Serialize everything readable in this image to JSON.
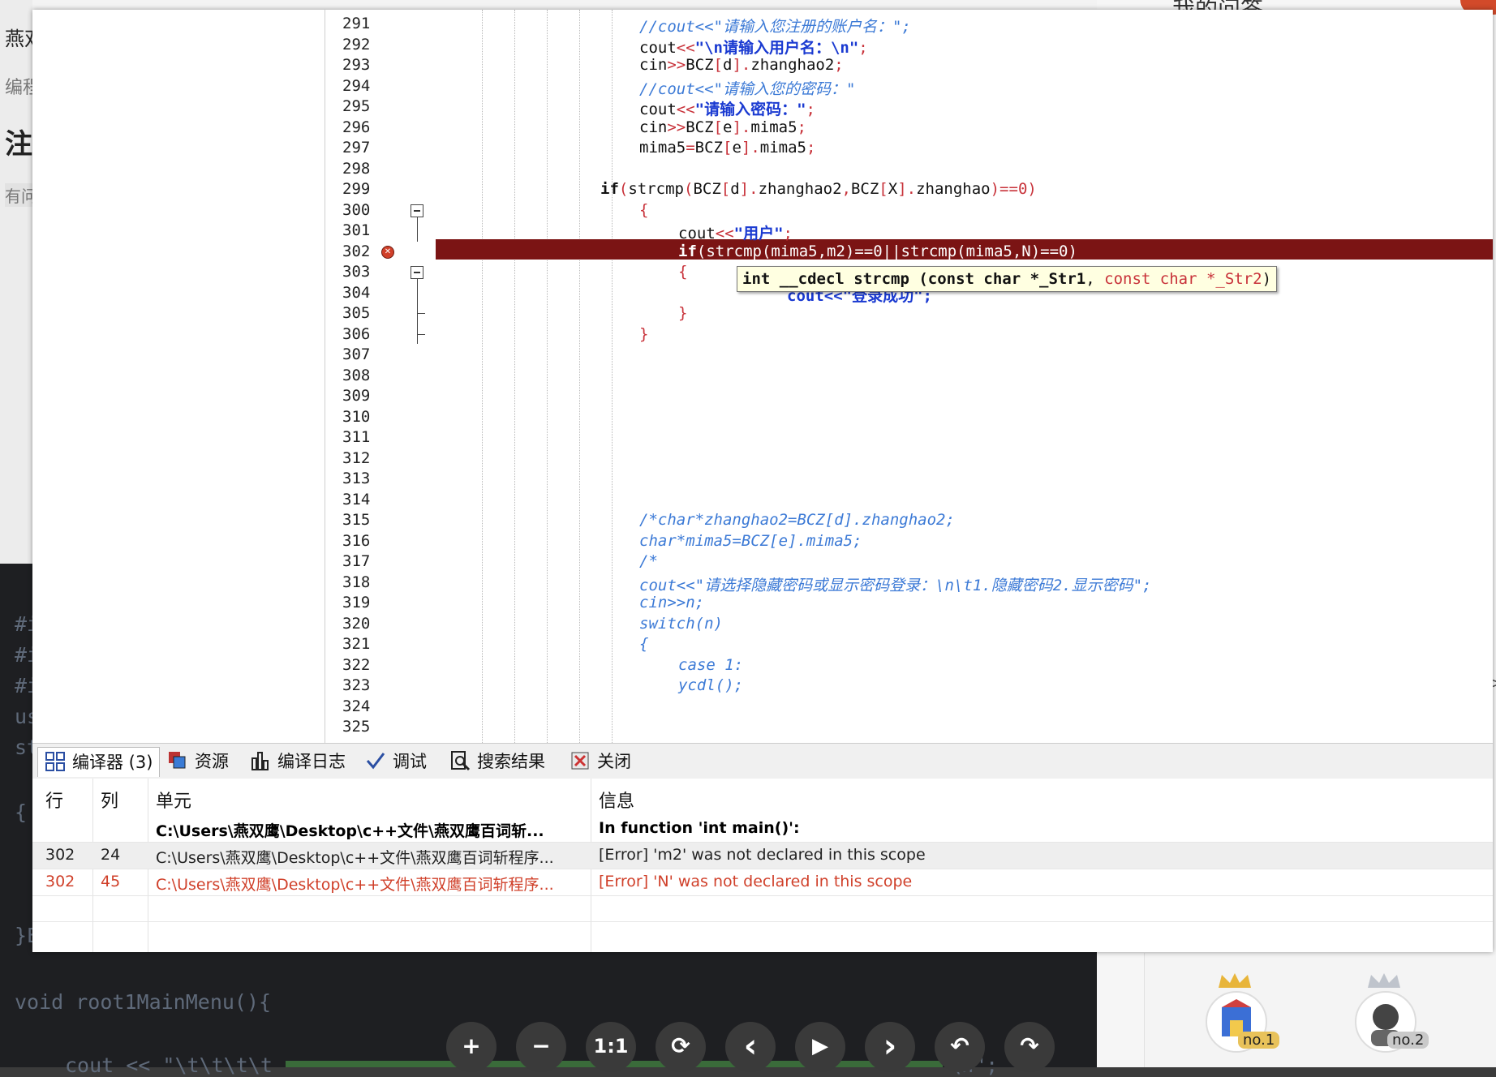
{
  "background": {
    "left_texts": [
      "燕双",
      "编程",
      "注",
      "有问"
    ],
    "right_title": "我的问答",
    "code_lines": [
      "#i",
      "#i",
      "#i",
      "us",
      "st",
      "{",
      "}E",
      "void root1MainMenu(){",
      "cout << \"\\t\\t\\t\\t",
      "\\n\";"
    ],
    "rank_1": "no.1",
    "rank_2": "no.2"
  },
  "editor": {
    "line_numbers": [
      "291",
      "292",
      "293",
      "294",
      "295",
      "296",
      "297",
      "298",
      "299",
      "300",
      "301",
      "302",
      "303",
      "304",
      "305",
      "306",
      "307",
      "308",
      "309",
      "310",
      "311",
      "312",
      "313",
      "314",
      "315",
      "316",
      "317",
      "318",
      "319",
      "320",
      "321",
      "322",
      "323",
      "324",
      "325"
    ],
    "tooltip": {
      "prefix": "int __cdecl strcmp (",
      "p1": "const char *_Str1",
      "sep": ", ",
      "p2": "const char *_Str2",
      "suffix": ")"
    },
    "hidden_line_fragment": "cout<<\"登录成功\";"
  },
  "tabs": [
    {
      "label": "编译器 (3)",
      "icon": "compiler-grid-icon"
    },
    {
      "label": "资源",
      "icon": "resources-icon"
    },
    {
      "label": "编译日志",
      "icon": "bar-chart-icon"
    },
    {
      "label": "调试",
      "icon": "checkmark-icon"
    },
    {
      "label": "搜索结果",
      "icon": "search-document-icon"
    },
    {
      "label": "关闭",
      "icon": "close-panel-icon"
    }
  ],
  "messages": {
    "headers": {
      "line": "行",
      "col": "列",
      "unit": "单元",
      "info": "信息"
    },
    "rows": [
      {
        "line": "",
        "col": "",
        "unit": "C:\\Users\\燕双鹰\\Desktop\\c++文件\\燕双鹰百词斩...",
        "info": "In function 'int main()':"
      },
      {
        "line": "302",
        "col": "24",
        "unit": "C:\\Users\\燕双鹰\\Desktop\\c++文件\\燕双鹰百词斩程序...",
        "info": "[Error] 'm2' was not declared in this scope"
      },
      {
        "line": "302",
        "col": "45",
        "unit": "C:\\Users\\燕双鹰\\Desktop\\c++文件\\燕双鹰百词斩程序...",
        "info": "[Error] 'N' was not declared in this scope"
      }
    ]
  },
  "viewer_toolbar": {
    "zoom_in": "+",
    "zoom_out": "−",
    "actual_size": "1:1",
    "rotate": "⟳",
    "prev": "‹",
    "play": "▶",
    "next": "›",
    "undo": "↶",
    "redo": "↷"
  },
  "colors": {
    "error_line": "#7b1414",
    "comment": "#3c7ad6",
    "string": "#1a3ad1",
    "operator": "#c8323a",
    "error_text": "#d0402a"
  }
}
